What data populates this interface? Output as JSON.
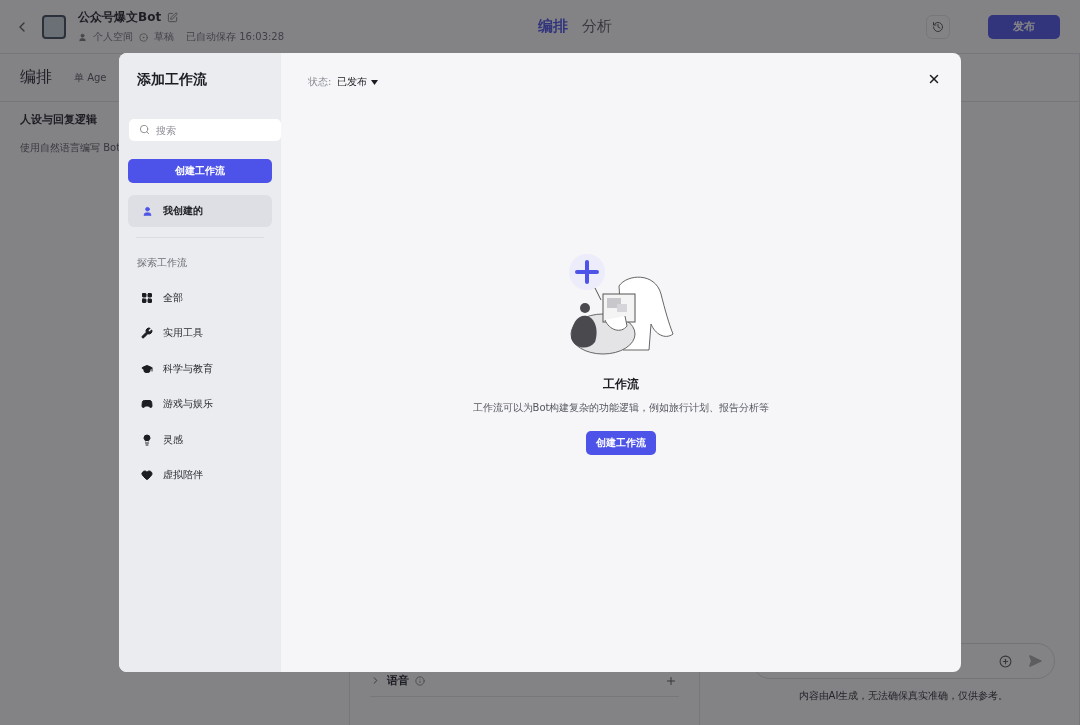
{
  "header": {
    "bot_name": "公众号爆文Bot",
    "space": "个人空间",
    "status": "草稿",
    "autosave": "已自动保存 16:03:28",
    "tabs": [
      {
        "label": "编排",
        "selected": true
      },
      {
        "label": "分析",
        "selected": false
      }
    ],
    "publish": "发布"
  },
  "toolbar": {
    "title": "编排",
    "mode": "单 Age"
  },
  "persona": {
    "title": "人设与回复逻辑",
    "hint": "使用自然语言编写 Bot"
  },
  "voice": {
    "label": "语音"
  },
  "chat": {
    "disclaimer": "内容由AI生成，无法确保真实准确，仅供参考。"
  },
  "modal": {
    "title": "添加工作流",
    "search": {
      "placeholder": "搜索"
    },
    "create": "创建工作流",
    "mine": {
      "label": "我创建的",
      "selected": true
    },
    "explore_title": "探索工作流",
    "categories": [
      {
        "label": "全部",
        "kind": "grid"
      },
      {
        "label": "实用工具",
        "kind": "wrench"
      },
      {
        "label": "科学与教育",
        "kind": "cap"
      },
      {
        "label": "游戏与娱乐",
        "kind": "gamepad"
      },
      {
        "label": "灵感",
        "kind": "bulb"
      },
      {
        "label": "虚拟陪伴",
        "kind": "heart"
      }
    ],
    "status_label": "状态:",
    "status_value": "已发布",
    "empty": {
      "title": "工作流",
      "description": "工作流可以为Bot构建复杂的功能逻辑，例如旅行计划、报告分析等",
      "button": "创建工作流"
    }
  }
}
